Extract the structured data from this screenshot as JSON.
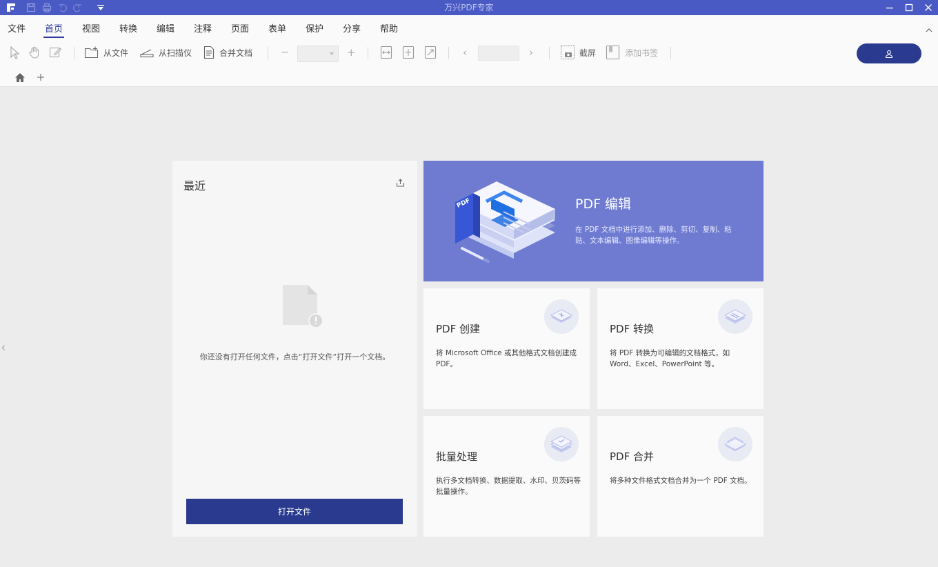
{
  "window": {
    "title": "万兴PDF专家"
  },
  "menu": {
    "items": [
      {
        "label": "文件"
      },
      {
        "label": "首页",
        "active": true
      },
      {
        "label": "视图"
      },
      {
        "label": "转换"
      },
      {
        "label": "编辑"
      },
      {
        "label": "注释"
      },
      {
        "label": "页面"
      },
      {
        "label": "表单"
      },
      {
        "label": "保护"
      },
      {
        "label": "分享"
      },
      {
        "label": "帮助"
      }
    ]
  },
  "toolbar": {
    "from_file": "从文件",
    "from_scanner": "从扫描仪",
    "merge_docs": "合并文档",
    "screenshot": "截屏",
    "add_bookmark": "添加书签",
    "zoom_minus": "−",
    "zoom_plus": "+",
    "prev_page": "‹",
    "next_page": "›"
  },
  "recent": {
    "title": "最近",
    "empty_message": "你还没有打开任何文件，点击“打开文件”打开一个文档。",
    "open_button": "打开文件"
  },
  "hero": {
    "title": "PDF 编辑",
    "description": "在 PDF 文档中进行添加、删除、剪切、复制、粘贴、文本编辑、图像编辑等操作。",
    "badge": "PDF"
  },
  "features": [
    {
      "title": "PDF 创建",
      "description": "将 Microsoft Office 或其他格式文档创建成 PDF。"
    },
    {
      "title": "PDF 转换",
      "description": "将 PDF 转换为可编辑的文档格式，如 Word、Excel、PowerPoint 等。"
    },
    {
      "title": "批量处理",
      "description": "执行多文档转换、数据提取、水印、贝茨码等批量操作。"
    },
    {
      "title": "PDF 合并",
      "description": "将多种文件格式文档合并为一个 PDF 文档。"
    }
  ],
  "colors": {
    "titlebar": "#4a5ac4",
    "accent": "#2a3a8e",
    "hero": "#6e7bd0"
  }
}
